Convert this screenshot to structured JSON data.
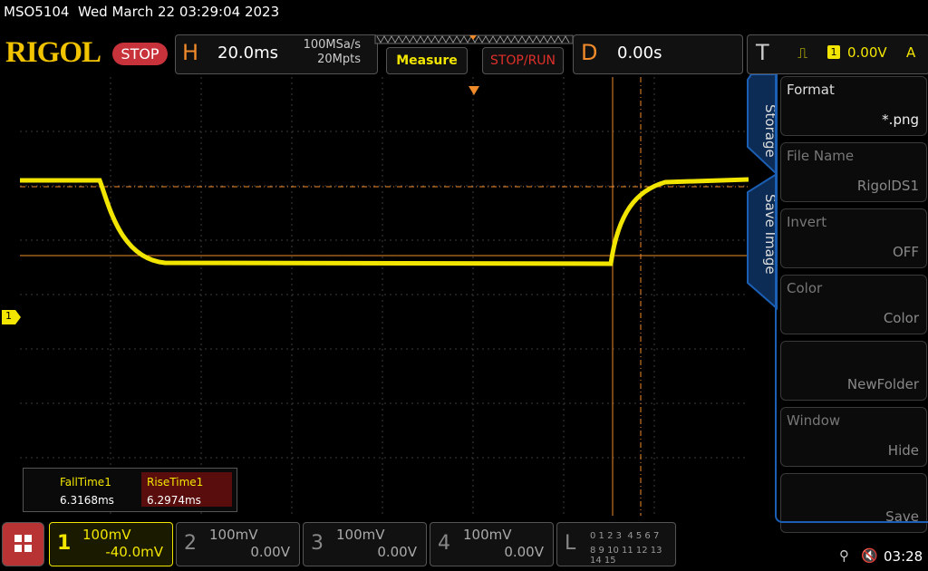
{
  "titlebar": {
    "model": "MSO5104",
    "datetime": "Wed March 22 03:29:04 2023"
  },
  "logo": "RIGOL",
  "status": "STOP",
  "horizontal": {
    "letter": "H",
    "timebase": "20.0ms",
    "sample_rate": "100MSa/s",
    "memory": "20Mpts"
  },
  "buttons": {
    "measure": "Measure",
    "stop_run": "STOP/RUN"
  },
  "delay": {
    "letter": "D",
    "value": "0.00s"
  },
  "trigger": {
    "letter": "T",
    "source": "1",
    "level": "0.00V",
    "mode": "A"
  },
  "measurements": [
    {
      "label": "FallTime1",
      "value": "6.3168ms"
    },
    {
      "label": "RiseTime1",
      "value": "6.2974ms"
    }
  ],
  "channel_marker": "1",
  "side_menu": {
    "tabs": [
      "Storage",
      "Save Image"
    ],
    "items": [
      {
        "title": "Format",
        "value": "*.png"
      },
      {
        "title": "File Name",
        "value": "RigolDS1"
      },
      {
        "title": "Invert",
        "value": "OFF"
      },
      {
        "title": "Color",
        "value": "Color"
      },
      {
        "title": "",
        "value": "NewFolder"
      },
      {
        "title": "Window",
        "value": "Hide"
      },
      {
        "title": "",
        "value": "Save"
      }
    ]
  },
  "channels": [
    {
      "num": "1",
      "scale": "100mV",
      "offset": "-40.0mV",
      "color": "#f2e600"
    },
    {
      "num": "2",
      "scale": "100mV",
      "offset": "0.00V"
    },
    {
      "num": "3",
      "scale": "100mV",
      "offset": "0.00V"
    },
    {
      "num": "4",
      "scale": "100mV",
      "offset": "0.00V"
    }
  ],
  "logic": {
    "letter": "L",
    "row1": "0 1 2 3  4 5 6 7",
    "row2": "8 9 10 11 12 13 14 15"
  },
  "clock": "03:28",
  "colors": {
    "ch1": "#f2e600",
    "cursor": "#f08a2a",
    "accent_blue": "#1b5fb5"
  }
}
